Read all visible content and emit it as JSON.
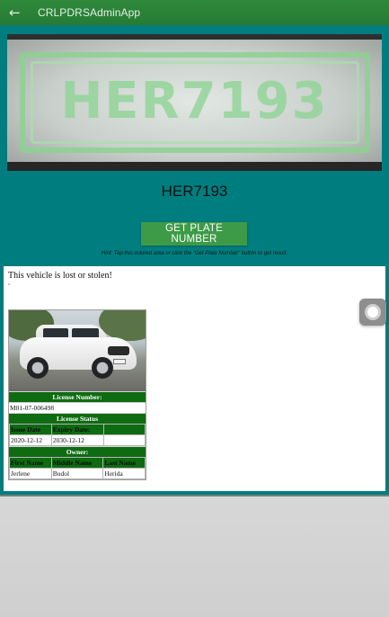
{
  "appbar": {
    "title": "CRLPDRSAdminApp",
    "back_icon": "arrow-left-icon"
  },
  "camera": {
    "plate_text": "HER7193"
  },
  "plate_number": "HER7193",
  "get_plate_button": "GET PLATE NUMBER",
  "hint": "Hint: Tap this colored area or click the \"Get Plate Number\" button to get result.",
  "result": {
    "message": "This vehicle is lost or stolen!",
    "license_number_label": "License Number:",
    "license_number": "M01-07-006498",
    "license_status_label": "License Status",
    "issue_date_label": "Issue Date",
    "expiry_date_label": "Expiry Date:",
    "issue_date": "2020-12-12",
    "expiry_date": "2030-12-12",
    "owner_label": "Owner:",
    "first_name_label": "First Name",
    "middle_name_label": "Middle Name",
    "last_name_label": "Last Name",
    "first_name": "Jerlene",
    "middle_name": "Budol",
    "last_name": "Herida"
  },
  "colors": {
    "appbar": "#2f8a3c",
    "panel": "#007d7f",
    "button": "#3d9b48",
    "table_header": "#0e6b12"
  }
}
